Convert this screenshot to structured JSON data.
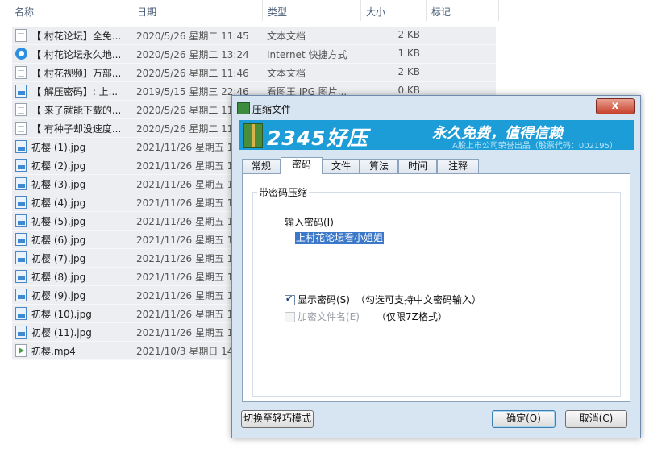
{
  "columns": {
    "name": "名称",
    "date": "日期",
    "type": "类型",
    "size": "大小",
    "tag": "标记"
  },
  "files": [
    {
      "icon": "text-document-icon",
      "name": "【 村花论坛】全免...",
      "date": "2020/5/26 星期二 11:45",
      "type": "文本文档",
      "size": "2 KB"
    },
    {
      "icon": "internet-shortcut-icon",
      "name": "【 村花论坛永久地...",
      "date": "2020/5/26 星期二 13:24",
      "type": "Internet 快捷方式",
      "size": "1 KB"
    },
    {
      "icon": "text-document-icon",
      "name": "【 村花视频】万部...",
      "date": "2020/5/26 星期二 11:46",
      "type": "文本文档",
      "size": "2 KB"
    },
    {
      "icon": "image-file-icon",
      "name": "【 解压密码】: 上...",
      "date": "2019/5/15 星期三 22:46",
      "type": "看图王 JPG 图片...",
      "size": "0 KB"
    },
    {
      "icon": "text-document-icon",
      "name": "【 来了就能下载的...",
      "date": "2020/5/26 星期二 11",
      "type": "",
      "size": ""
    },
    {
      "icon": "text-document-icon",
      "name": "【 有种子却没速度...",
      "date": "2020/5/26 星期二 11",
      "type": "",
      "size": ""
    },
    {
      "icon": "image-file-icon",
      "name": "初樱 (1).jpg",
      "date": "2021/11/26 星期五 1",
      "type": "",
      "size": ""
    },
    {
      "icon": "image-file-icon",
      "name": "初樱 (2).jpg",
      "date": "2021/11/26 星期五 1",
      "type": "",
      "size": ""
    },
    {
      "icon": "image-file-icon",
      "name": "初樱 (3).jpg",
      "date": "2021/11/26 星期五 1",
      "type": "",
      "size": ""
    },
    {
      "icon": "image-file-icon",
      "name": "初樱 (4).jpg",
      "date": "2021/11/26 星期五 1",
      "type": "",
      "size": ""
    },
    {
      "icon": "image-file-icon",
      "name": "初樱 (5).jpg",
      "date": "2021/11/26 星期五 1",
      "type": "",
      "size": ""
    },
    {
      "icon": "image-file-icon",
      "name": "初樱 (6).jpg",
      "date": "2021/11/26 星期五 1",
      "type": "",
      "size": ""
    },
    {
      "icon": "image-file-icon",
      "name": "初樱 (7).jpg",
      "date": "2021/11/26 星期五 1",
      "type": "",
      "size": ""
    },
    {
      "icon": "image-file-icon",
      "name": "初樱 (8).jpg",
      "date": "2021/11/26 星期五 1",
      "type": "",
      "size": ""
    },
    {
      "icon": "image-file-icon",
      "name": "初樱 (9).jpg",
      "date": "2021/11/26 星期五 1",
      "type": "",
      "size": ""
    },
    {
      "icon": "image-file-icon",
      "name": "初樱 (10).jpg",
      "date": "2021/11/26 星期五 1",
      "type": "",
      "size": ""
    },
    {
      "icon": "image-file-icon",
      "name": "初樱 (11).jpg",
      "date": "2021/11/26 星期五 1",
      "type": "",
      "size": ""
    },
    {
      "icon": "video-file-icon",
      "name": "初樱.mp4",
      "date": "2021/10/3 星期日 14",
      "type": "",
      "size": ""
    }
  ],
  "dialog": {
    "title": "压缩文件",
    "close_label": "x",
    "banner": {
      "brand": "2345好压",
      "slogan": "永久免费，值得信赖",
      "sub": "A股上市公司荣誉出品（股票代码：002195）"
    },
    "tabs": [
      "常规",
      "密码",
      "文件",
      "算法",
      "时间",
      "注释"
    ],
    "active_tab": "密码",
    "group_title": "带密码压缩",
    "password_label": "输入密码(I)",
    "password_value": "上村花论坛看小姐姐",
    "show_password_label": "显示密码(S)",
    "show_password_checked": true,
    "show_password_hint": "（勾选可支持中文密码输入）",
    "encrypt_names_label": "加密文件名(E)",
    "encrypt_names_checked": false,
    "encrypt_names_hint": "（仅限7Z格式）",
    "switch_mode_label": "切换至轻巧模式",
    "ok_label": "确定(O)",
    "cancel_label": "取消(C)"
  }
}
